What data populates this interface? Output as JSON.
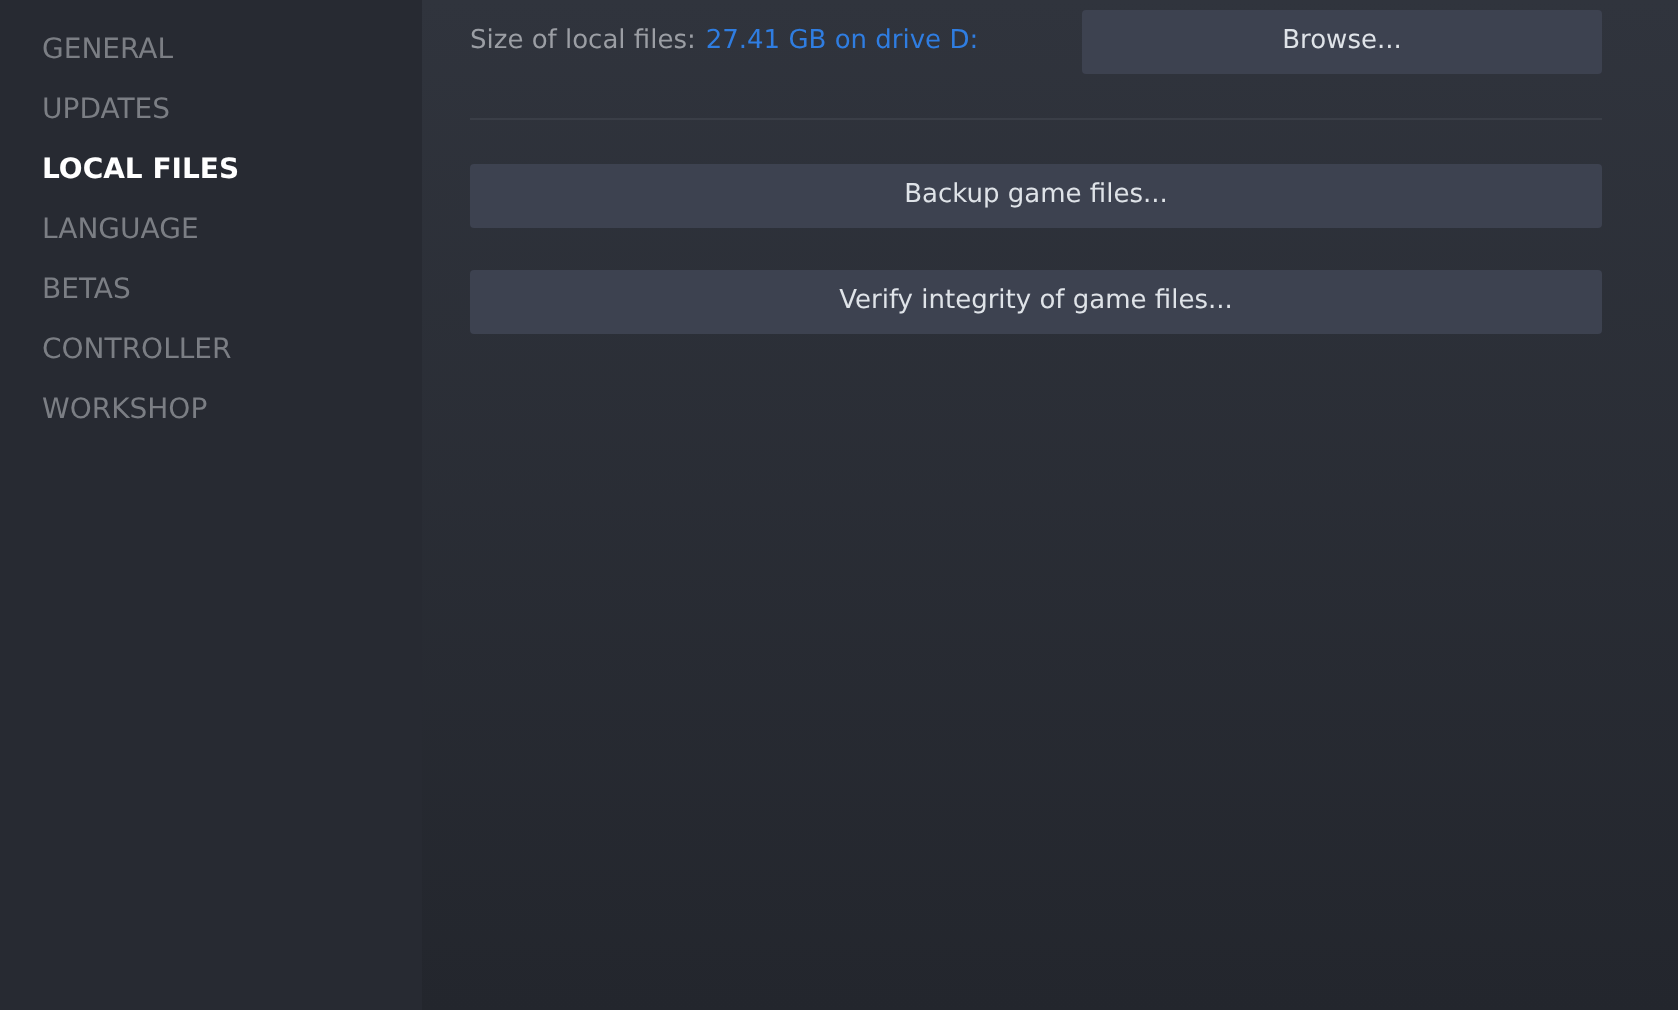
{
  "sidebar": {
    "items": [
      {
        "label": "GENERAL",
        "selected": false
      },
      {
        "label": "UPDATES",
        "selected": false
      },
      {
        "label": "LOCAL FILES",
        "selected": true
      },
      {
        "label": "LANGUAGE",
        "selected": false
      },
      {
        "label": "BETAS",
        "selected": false
      },
      {
        "label": "CONTROLLER",
        "selected": false
      },
      {
        "label": "WORKSHOP",
        "selected": false
      }
    ]
  },
  "local_files": {
    "size_label": "Size of local files:",
    "size_value": "27.41 GB on drive D:",
    "browse_button": "Browse...",
    "buttons": [
      "Backup game files...",
      "Verify integrity of game files..."
    ]
  }
}
